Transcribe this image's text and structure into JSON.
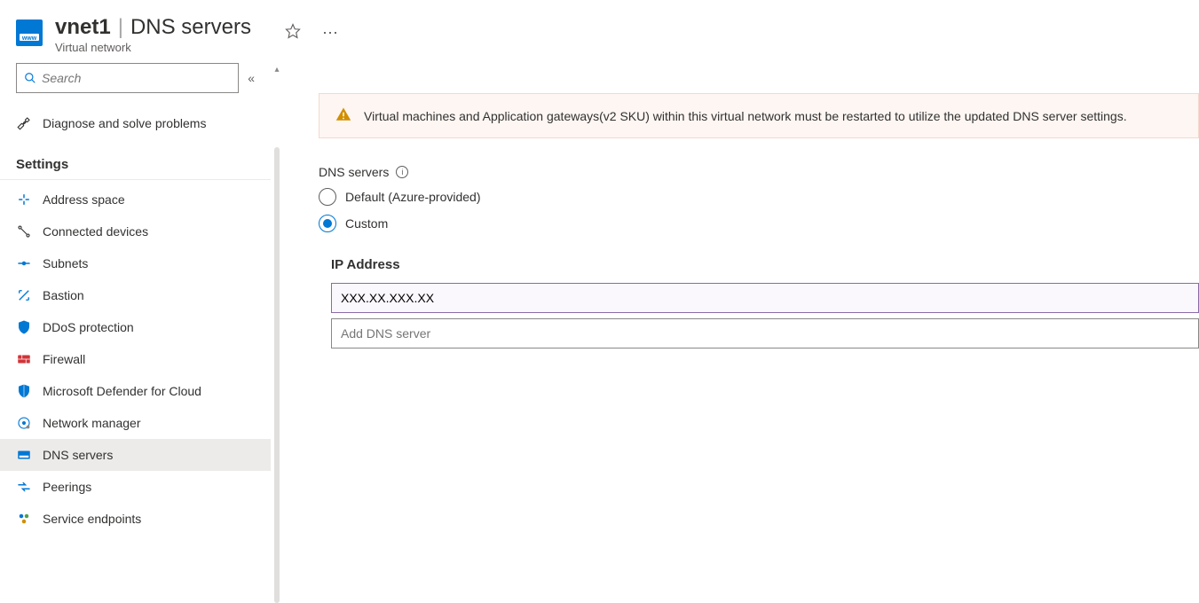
{
  "header": {
    "resource_name": "vnet1",
    "page_title": "DNS servers",
    "resource_type": "Virtual network"
  },
  "sidebar": {
    "search_placeholder": "Search",
    "diagnose_label": "Diagnose and solve problems",
    "section_settings": "Settings",
    "items": [
      {
        "label": "Address space",
        "icon": "address-space-icon"
      },
      {
        "label": "Connected devices",
        "icon": "connected-devices-icon"
      },
      {
        "label": "Subnets",
        "icon": "subnets-icon"
      },
      {
        "label": "Bastion",
        "icon": "bastion-icon"
      },
      {
        "label": "DDoS protection",
        "icon": "shield-icon"
      },
      {
        "label": "Firewall",
        "icon": "firewall-icon"
      },
      {
        "label": "Microsoft Defender for Cloud",
        "icon": "defender-icon"
      },
      {
        "label": "Network manager",
        "icon": "network-manager-icon"
      },
      {
        "label": "DNS servers",
        "icon": "dns-icon",
        "active": true
      },
      {
        "label": "Peerings",
        "icon": "peerings-icon"
      },
      {
        "label": "Service endpoints",
        "icon": "service-endpoints-icon"
      }
    ]
  },
  "main": {
    "banner_text": "Virtual machines and Application gateways(v2 SKU) within this virtual network must be restarted to utilize the updated DNS server settings.",
    "dns_label": "DNS servers",
    "radio_default": "Default (Azure-provided)",
    "radio_custom": "Custom",
    "selected_option": "custom",
    "ip_header": "IP Address",
    "ip_value": "XXX.XX.XXX.XX",
    "add_placeholder": "Add DNS server"
  }
}
